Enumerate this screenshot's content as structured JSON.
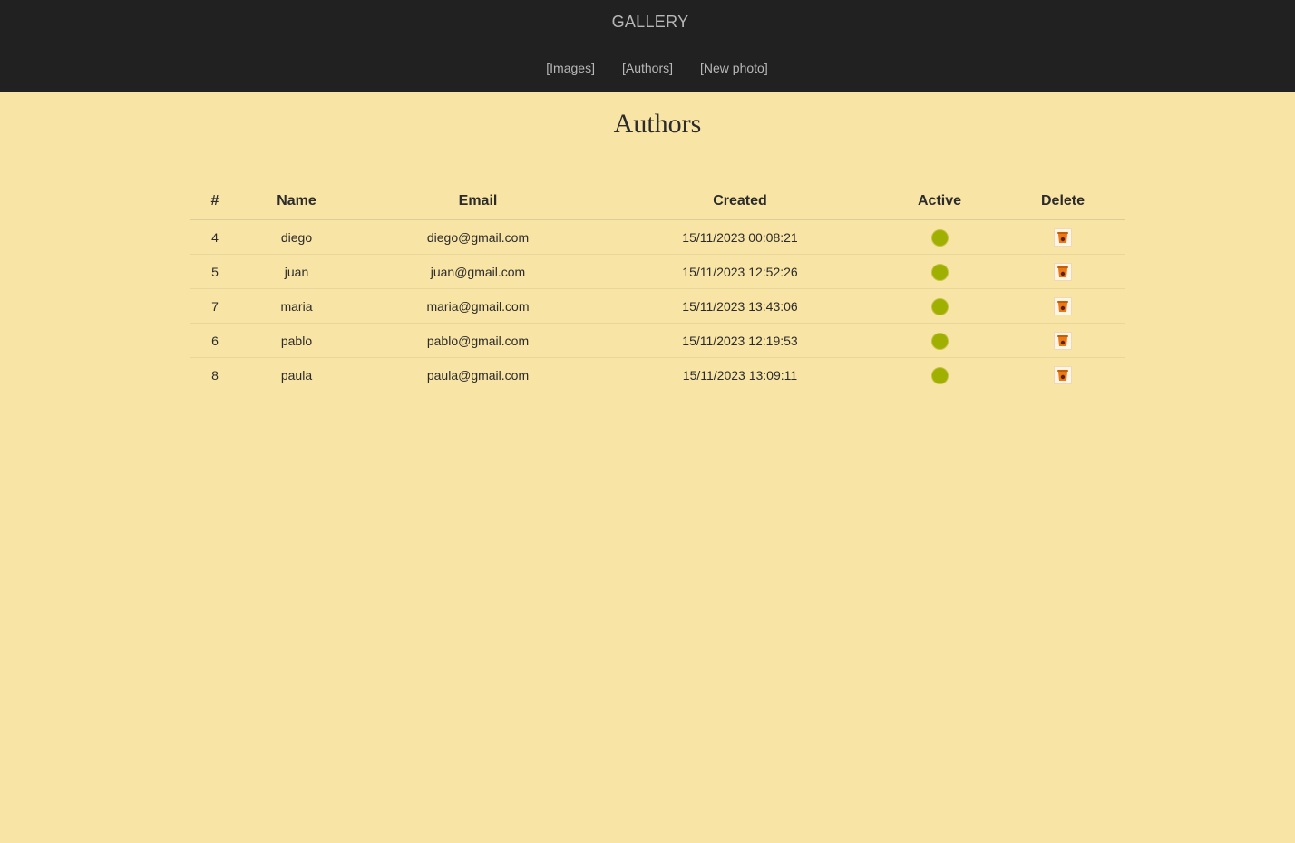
{
  "header": {
    "brand": "GALLERY",
    "nav": [
      "[Images]",
      "[Authors]",
      "[New photo]"
    ]
  },
  "page": {
    "title": "Authors"
  },
  "table": {
    "columns": [
      "#",
      "Name",
      "Email",
      "Created",
      "Active",
      "Delete"
    ],
    "rows": [
      {
        "id": "4",
        "name": "diego",
        "email": "diego@gmail.com",
        "created": "15/11/2023 00:08:21"
      },
      {
        "id": "5",
        "name": "juan",
        "email": "juan@gmail.com",
        "created": "15/11/2023 12:52:26"
      },
      {
        "id": "7",
        "name": "maria",
        "email": "maria@gmail.com",
        "created": "15/11/2023 13:43:06"
      },
      {
        "id": "6",
        "name": "pablo",
        "email": "pablo@gmail.com",
        "created": "15/11/2023 12:19:53"
      },
      {
        "id": "8",
        "name": "paula",
        "email": "paula@gmail.com",
        "created": "15/11/2023 13:09:11"
      }
    ]
  },
  "colors": {
    "background": "#f8e4a5",
    "topbar": "#212121",
    "active_dot": "#9fb000"
  },
  "icons": {
    "active": "active-status-icon",
    "delete": "trash-can-icon"
  }
}
